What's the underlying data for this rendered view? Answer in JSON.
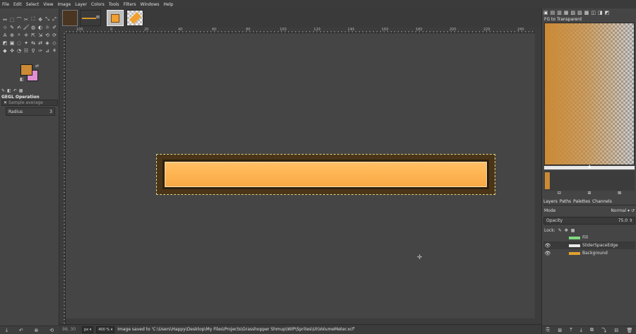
{
  "menu": [
    "File",
    "Edit",
    "Select",
    "View",
    "Image",
    "Layer",
    "Colors",
    "Tools",
    "Filters",
    "Windows",
    "Help"
  ],
  "toolbox": {
    "tools": [
      "↔",
      "⬚",
      "⌒",
      "✂",
      "⛶",
      "✥",
      "⤡",
      "⤢",
      "⊹",
      "✎",
      "✍",
      "🖌",
      "◍",
      "◐",
      "☼",
      "✐",
      "A",
      "⊕",
      "⌕",
      "✛",
      "⇱",
      "⇲",
      "⟲",
      "⟳",
      "◩",
      "▣",
      "◌",
      "✦",
      "⇆",
      "⇄",
      "◈",
      "◇",
      "◆",
      "✜",
      "◔",
      "☷",
      "⚲",
      "✑",
      "⊿",
      "⚘"
    ],
    "fg_color": "#cc8a35",
    "bg_color": "#e08fd0",
    "swap_icon": "⇄",
    "reset_icon": "◧",
    "option_tabs": [
      "✎",
      "◧",
      "↶",
      "▦"
    ],
    "gegl_title": "GEGL Operation",
    "gegl_placeholder": "Sample average",
    "radius_label": "Radius",
    "radius_value": "3",
    "bottom_icons": [
      "⤓",
      "↶",
      "⊗",
      "⟲"
    ]
  },
  "canvas": {
    "ruler_labels": [
      "100",
      "0",
      "20",
      "40",
      "60",
      "80",
      "100",
      "120",
      "140",
      "160",
      "180",
      "200",
      "220",
      "240"
    ],
    "meter_fill_color": "#ffb655",
    "meter_frame_color": "#4a3519"
  },
  "status": {
    "coords": "98, 30",
    "unit": "px ▾",
    "zoom": "400 % ▾",
    "message": "Image saved to 'C:\\Users\\Happy\\Desktop\\My Files\\Projects\\Grasshopper Shmup\\WIP\\Sprites\\UI\\VolumeMeter.xcf'"
  },
  "right_dock": {
    "top_tabs": [
      "▣",
      "▤",
      "▥",
      "▦",
      "▧",
      "▨",
      "▩",
      "◫",
      "◨",
      "◩"
    ],
    "gradient_name": "FG to Transparent",
    "gradient_buttons": [
      "⊟",
      "⊞",
      "⊠"
    ],
    "layer_tabs": [
      "Layers",
      "Paths",
      "Palettes",
      "Channels"
    ],
    "mode_label": "Mode",
    "mode_value": "Normal",
    "opacity_label": "Opacity",
    "opacity_value": "75.0",
    "lock_label": "Lock:",
    "layers": [
      {
        "name": "Fill",
        "visible": false,
        "color": "#7fd97f"
      },
      {
        "name": "SliderSpaceEdge",
        "visible": true,
        "color": "#e8e8e8"
      },
      {
        "name": "Background",
        "visible": true,
        "color": "#e0a030"
      }
    ],
    "bottom_icons": [
      "⎘",
      "⊞",
      "⤒",
      "⤓",
      "⧉",
      "⤵",
      "⊟",
      "🗑"
    ]
  }
}
